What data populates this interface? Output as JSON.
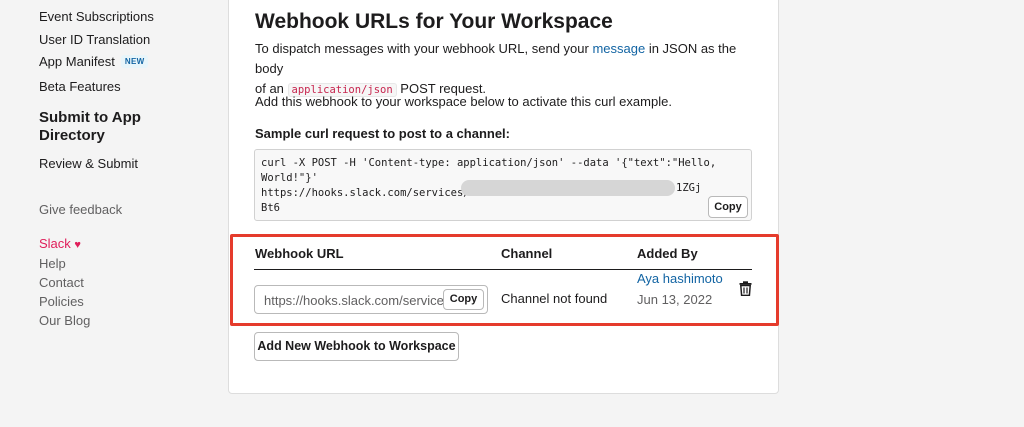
{
  "sidebar": {
    "items": [
      {
        "label": "Event Subscriptions"
      },
      {
        "label": "User ID Translation"
      },
      {
        "label": "App Manifest",
        "badge": "NEW"
      },
      {
        "label": "Beta Features"
      }
    ],
    "section_heading": "Submit to App Directory",
    "review_label": "Review & Submit",
    "feedback_label": "Give feedback",
    "footer": {
      "slack_label": "Slack",
      "slack_heart": "♥",
      "links": [
        "Help",
        "Contact",
        "Policies",
        "Our Blog"
      ]
    }
  },
  "main": {
    "title": "Webhook URLs for Your Workspace",
    "intro": {
      "part1": "To dispatch messages with your webhook URL, send your ",
      "link": "message",
      "part2": " in JSON as the body",
      "part3": "of an ",
      "code": "application/json",
      "part4": " POST request."
    },
    "activate_text": "Add this webhook to your workspace below to activate this curl example.",
    "sample_label": "Sample curl request to post to a channel:",
    "curl": {
      "line1": "curl -X POST -H 'Content-type: application/json' --data '{\"text\":\"Hello,",
      "line2": "World!\"}'",
      "line3_start": "https://hooks.slack.com/services/T",
      "line3_end": "1ZGj",
      "line4": "Bt6"
    },
    "copy_label": "Copy",
    "table": {
      "headers": [
        "Webhook URL",
        "Channel",
        "Added By"
      ],
      "row": {
        "url": "https://hooks.slack.com/services/",
        "copy_label": "Copy",
        "channel": "Channel not found",
        "added_by": "Aya hashimoto",
        "date": "Jun 13, 2022",
        "delete_icon": "trash-icon"
      }
    },
    "add_button": "Add New Webhook to Workspace"
  },
  "colors": {
    "link": "#1264a3",
    "highlight_border": "#e53b2c",
    "slack_pink": "#e01e5a"
  }
}
